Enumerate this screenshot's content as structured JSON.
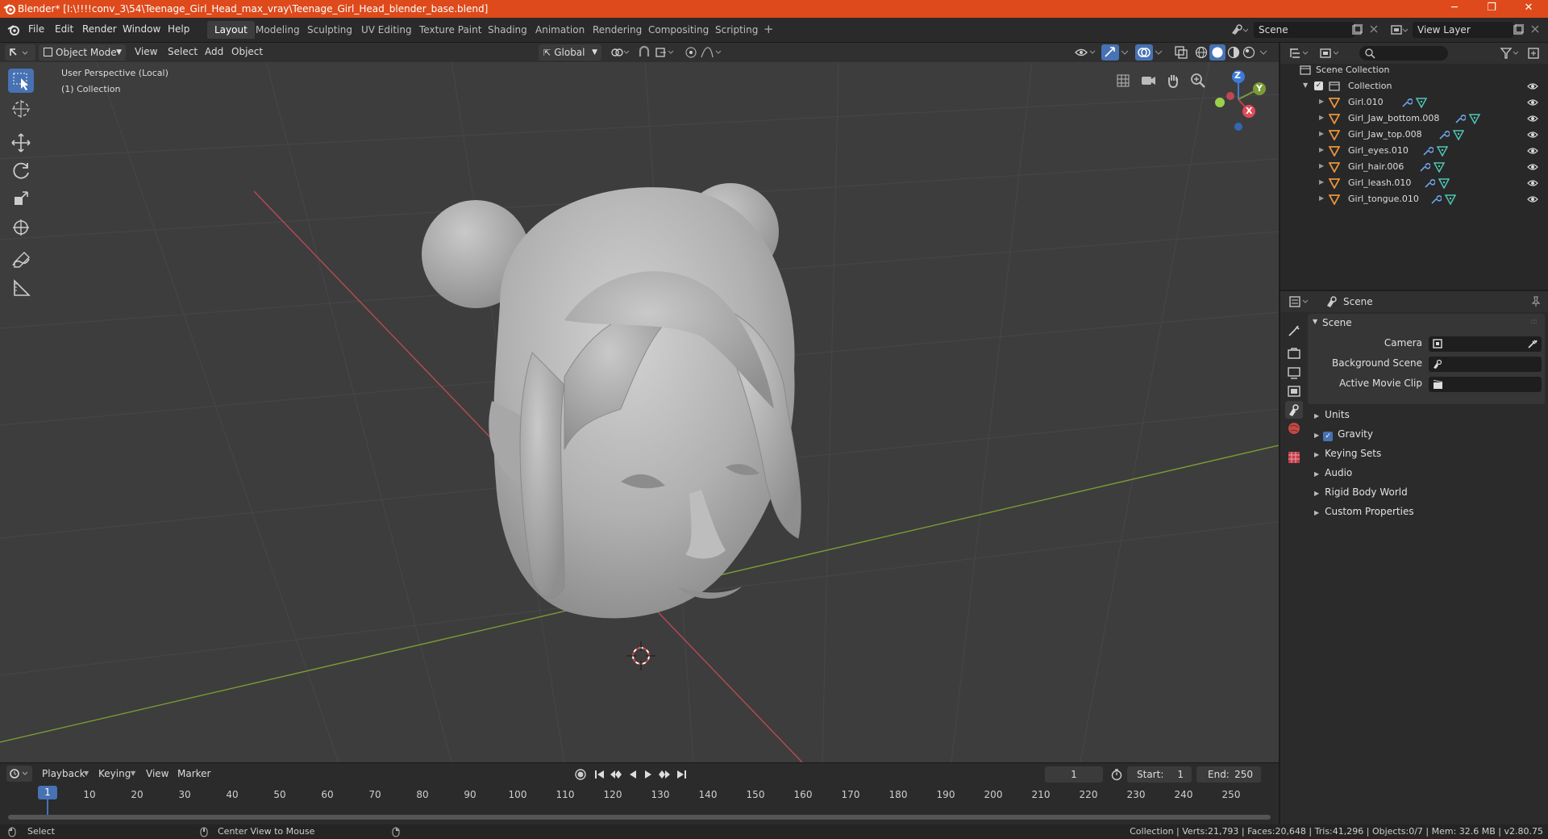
{
  "titlebar": {
    "title": "Blender* [I:\\!!!!conv_3\\54\\Teenage_Girl_Head_max_vray\\Teenage_Girl_Head_blender_base.blend]",
    "minimize": "─",
    "maximize": "❐",
    "close": "✕"
  },
  "menu": [
    "File",
    "Edit",
    "Render",
    "Window",
    "Help"
  ],
  "workspaces": [
    "Layout",
    "Modeling",
    "Sculpting",
    "UV Editing",
    "Texture Paint",
    "Shading",
    "Animation",
    "Rendering",
    "Compositing",
    "Scripting"
  ],
  "workspace_add": "+",
  "scene_field": "Scene",
  "view_layer_field": "View Layer",
  "viewport_header": {
    "mode": "Object Mode",
    "menus": [
      "View",
      "Select",
      "Add",
      "Object"
    ],
    "transform": "Global"
  },
  "viewport": {
    "perspective": "User Perspective (Local)",
    "collection": "(1) Collection",
    "gizmo": {
      "z": "Z",
      "y": "Y",
      "x": "X"
    }
  },
  "timeline": {
    "menus": [
      "Playback",
      "Keying",
      "View",
      "Marker"
    ],
    "current_frame": "1",
    "start_label": "Start:",
    "start": "1",
    "end_label": "End:",
    "end": "250",
    "marker": "1",
    "ticks": [
      "10",
      "20",
      "30",
      "40",
      "50",
      "60",
      "70",
      "80",
      "90",
      "100",
      "110",
      "120",
      "130",
      "140",
      "150",
      "160",
      "170",
      "180",
      "190",
      "200",
      "210",
      "220",
      "230",
      "240",
      "250"
    ]
  },
  "statusbar": {
    "select": "Select",
    "center": "Center View to Mouse",
    "stats": "Collection | Verts:21,793 | Faces:20,648 | Tris:41,296 | Objects:0/7 | Mem: 32.6 MB | v2.80.75"
  },
  "outliner": {
    "root": "Scene Collection",
    "collection": "Collection",
    "objects": [
      "Girl.010",
      "Girl_Jaw_bottom.008",
      "Girl_Jaw_top.008",
      "Girl_eyes.010",
      "Girl_hair.006",
      "Girl_leash.010",
      "Girl_tongue.010"
    ]
  },
  "properties": {
    "header": "Scene",
    "panel": "Scene",
    "camera_label": "Camera",
    "background_label": "Background Scene",
    "movie_clip_label": "Active Movie Clip",
    "sections": [
      "Units",
      "Gravity",
      "Keying Sets",
      "Audio",
      "Rigid Body World",
      "Custom Properties"
    ]
  },
  "colors": {
    "titlebar": "#de4a1b",
    "accent": "#4772b3",
    "viewport": "#3d3d3d",
    "x_axis": "#b84a56",
    "y_axis": "#7a9c34",
    "object_icon": "#e8953a",
    "mesh_icon": "#4ec6b4"
  }
}
